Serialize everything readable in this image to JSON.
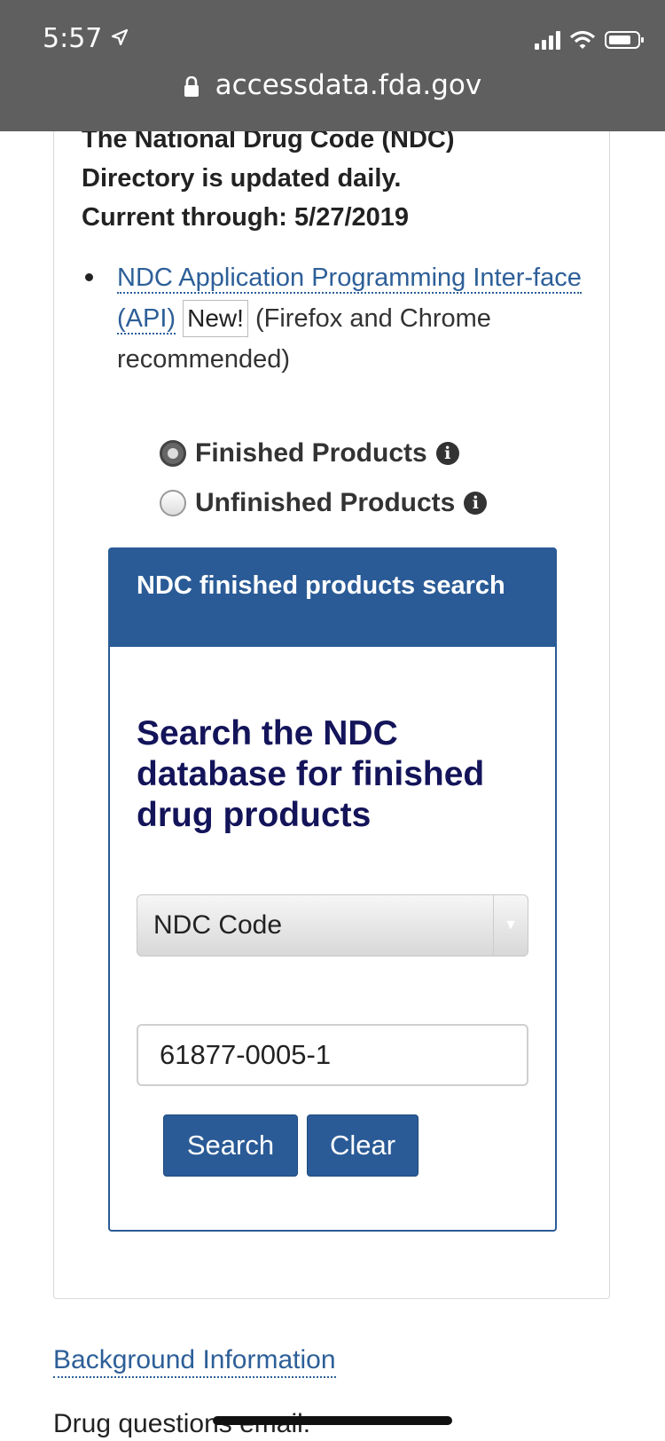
{
  "status_bar": {
    "time": "5:57",
    "url": "accessdata.fda.gov"
  },
  "intro": {
    "line1": "The National Drug Code (NDC)",
    "line2": "Directory is updated daily.",
    "line3": "Current through: 5/27/2019"
  },
  "api_item": {
    "link_text": "NDC Application Programming Inter-face (API)",
    "badge": "New!",
    "note": "(Firefox and Chrome recommended)"
  },
  "product_type": {
    "options": [
      {
        "label": "Finished Products",
        "selected": true
      },
      {
        "label": "Unfinished Products",
        "selected": false
      }
    ]
  },
  "search": {
    "header": "NDC finished products search",
    "title": "Search the NDC database for finished drug products",
    "field_select": "NDC Code",
    "query_value": "61877-0005-1",
    "search_label": "Search",
    "clear_label": "Clear"
  },
  "footer": {
    "background_link": "Background Information",
    "drug_questions": "Drug questions email:"
  },
  "colors": {
    "topbar": "#5f5f5f",
    "primary": "#2a5b96",
    "link": "#2d5f98",
    "title": "#14145a"
  }
}
